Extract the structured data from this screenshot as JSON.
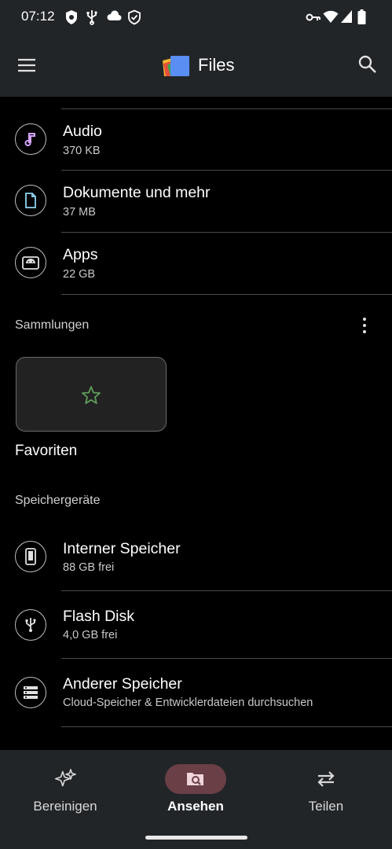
{
  "status_bar": {
    "time": "07:12"
  },
  "app_bar": {
    "title": "Files"
  },
  "categories": [
    {
      "title": "Audio",
      "subtitle": "370 KB"
    },
    {
      "title": "Dokumente und mehr",
      "subtitle": "37 MB"
    },
    {
      "title": "Apps",
      "subtitle": "22 GB"
    }
  ],
  "collections": {
    "label": "Sammlungen",
    "favorites_label": "Favoriten"
  },
  "storage": {
    "label": "Speichergeräte",
    "items": [
      {
        "title": "Interner Speicher",
        "subtitle": "88 GB frei"
      },
      {
        "title": "Flash Disk",
        "subtitle": "4,0 GB frei"
      },
      {
        "title": "Anderer Speicher",
        "subtitle": "Cloud-Speicher & Entwicklerdateien durchsuchen"
      }
    ]
  },
  "bottom_nav": {
    "items": [
      {
        "label": "Bereinigen",
        "icon": "sparkle-icon"
      },
      {
        "label": "Ansehen",
        "icon": "browse-icon",
        "active": true
      },
      {
        "label": "Teilen",
        "icon": "swap-icon"
      }
    ]
  },
  "colors": {
    "bar_bg": "#222528",
    "accent_active": "#6a3f46",
    "audio_icon": "#d6a4ff",
    "doc_icon": "#8fd3f0",
    "star": "#5f9c5a"
  }
}
